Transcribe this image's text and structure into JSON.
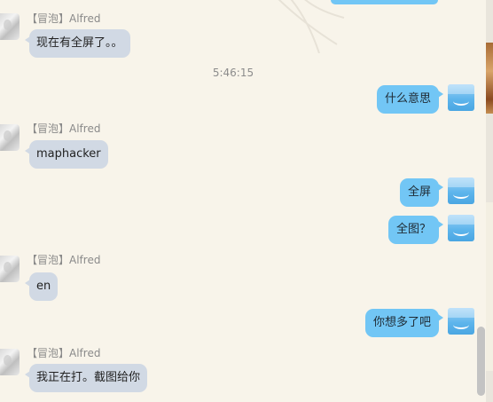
{
  "timestamp": "5:46:15",
  "contact": {
    "tag": "【冒泡】",
    "name": "Alfred"
  },
  "messages": [
    {
      "side": "left",
      "text": "现在有全屏了。。"
    },
    {
      "side": "right",
      "text": "什么意思"
    },
    {
      "side": "left",
      "text": "maphacker"
    },
    {
      "side": "right",
      "text": "全屏"
    },
    {
      "side": "right",
      "text": "全图？"
    },
    {
      "side": "left",
      "text": "en"
    },
    {
      "side": "right",
      "text": "你想多了吧"
    },
    {
      "side": "left",
      "text": "我正在打。截图给你"
    }
  ],
  "colors": {
    "background": "#f8f4ea",
    "incoming_bubble": "#d1d9e4",
    "outgoing_bubble": "#72c6f5",
    "sender_text": "#8a8a8a"
  },
  "icons": {
    "contact_avatar": "anime-avatar-icon",
    "self_avatar": "blue-smiley-avatar-icon"
  }
}
